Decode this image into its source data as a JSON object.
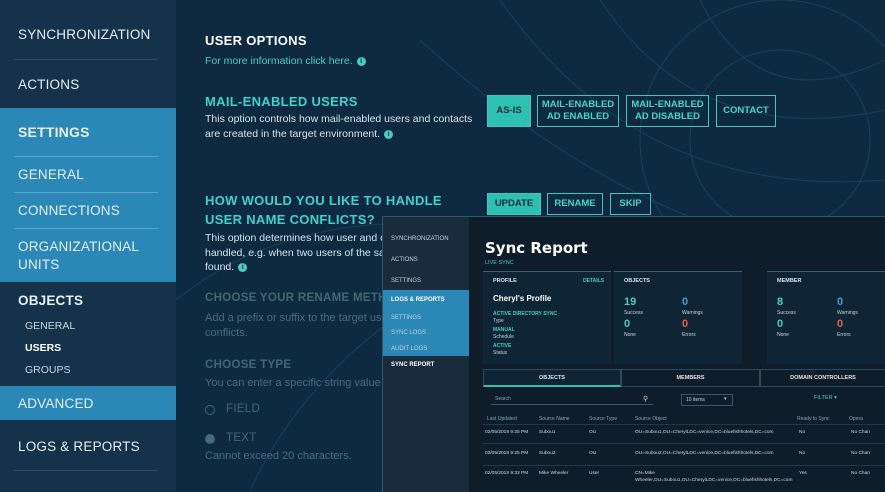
{
  "sidebar": {
    "items": [
      {
        "label": "SYNCHRONIZATION"
      },
      {
        "label": "ACTIONS"
      },
      {
        "label": "SETTINGS"
      },
      {
        "label": "GENERAL"
      },
      {
        "label": "CONNECTIONS"
      },
      {
        "label": "ORGANIZATIONAL"
      },
      {
        "label": "UNITS"
      },
      {
        "label": "OBJECTS"
      },
      {
        "label": "ADVANCED"
      },
      {
        "label": "LOGS & REPORTS"
      }
    ],
    "objects_sub": [
      "GENERAL",
      "USERS",
      "GROUPS"
    ]
  },
  "main": {
    "title": "USER OPTIONS",
    "more_info": "For more information click here.",
    "mail_title": "MAIL-ENABLED USERS",
    "mail_desc_1": "This option controls how mail-enabled users and contacts",
    "mail_desc_2": "are created in the target environment.",
    "mail_buttons": [
      {
        "l1": "AS-IS",
        "l2": ""
      },
      {
        "l1": "MAIL-ENABLED",
        "l2": "AD ENABLED"
      },
      {
        "l1": "MAIL-ENABLED",
        "l2": "AD DISABLED"
      },
      {
        "l1": "CONTACT",
        "l2": ""
      }
    ],
    "conflict_title_1": "HOW WOULD YOU LIKE TO HANDLE",
    "conflict_title_2": "USER NAME CONFLICTS?",
    "conflict_buttons": [
      "UPDATE",
      "RENAME",
      "SKIP"
    ],
    "conflict_desc_1": "This option determines how user and co",
    "conflict_desc_2": "handled, e.g. when two users of the sam",
    "conflict_desc_3": "found.",
    "rename_title": "CHOOSE YOUR RENAME METHOD",
    "rename_desc_1": "Add a prefix or suffix to the target user f",
    "rename_desc_2": "conflicts.",
    "type_title": "CHOOSE TYPE",
    "type_desc": "You can enter a specific string value or s",
    "radio_field": "FIELD",
    "radio_text": "TEXT",
    "limit": "Cannot exceed 20 characters."
  },
  "overlay": {
    "side": [
      "SYNCHRONIZATION",
      "ACTIONS",
      "SETTINGS",
      "LOGS & REPORTS",
      "SETTINGS",
      "SYNC LOGS",
      "AUDIT LOGS",
      "SYNC REPORT"
    ],
    "title": "Sync Report",
    "live": "LIVE SYNC",
    "profile": {
      "h": "PROFILE",
      "details": "DETAILS",
      "name": "Cheryl's Profile",
      "type_v": "ACTIVE DIRECTORY SYNC",
      "type_l": "Type",
      "sched_v": "MANUAL",
      "sched_l": "Schedule",
      "status_v": "ACTIVE",
      "status_l": "Status"
    },
    "objects": {
      "h": "OBJECTS",
      "n1": "19",
      "l1": "Success",
      "n2": "0",
      "l2": "Warnings",
      "n3": "0",
      "l3": "None",
      "n4": "0",
      "l4": "Errors"
    },
    "member": {
      "h": "MEMBER",
      "n1": "8",
      "l1": "Success",
      "n2": "0",
      "l2": "Warnings",
      "n3": "0",
      "l3": "None",
      "n4": "0",
      "l4": "Errors"
    },
    "tabs": [
      "OBJECTS",
      "MEMBERS",
      "DOMAIN CONTROLLERS"
    ],
    "search_ph": "Search",
    "page_size": "10 items",
    "filter": "FILTER",
    "headers": [
      "Last Updated",
      "Source Name",
      "Source Type",
      "Source Object",
      "Ready to Sync",
      "Opera"
    ],
    "rows": [
      {
        "d": "02/05/2018 9:25 PM",
        "n": "Subou1",
        "t": "OU",
        "o": "OU=Subou1,OU=CherylLDC=venice,DC=bluefishhotels,DC=com",
        "r": "No",
        "op": "No Chan"
      },
      {
        "d": "02/05/2018 9:25 PM",
        "n": "Subou2",
        "t": "OU",
        "o": "OU=Subou2,OU=CherylLDC=venice,DC=bluefishhotels,DC=com",
        "r": "No",
        "op": "No Chan"
      },
      {
        "d": "02/05/2018 9:33 PM",
        "n": "Mike Wheeler",
        "t": "User",
        "o": "CN=Mike",
        "o2": "Wheeler,OU=Subou1,OU=CherylLDC=venice,DC=bluefishhotels,DC=com",
        "r": "Yes",
        "op": "No Chan"
      }
    ]
  },
  "colors": {
    "accent": "#2ec1b1",
    "sidebar_active": "#2a87b6",
    "bg": "#0e2a40"
  }
}
